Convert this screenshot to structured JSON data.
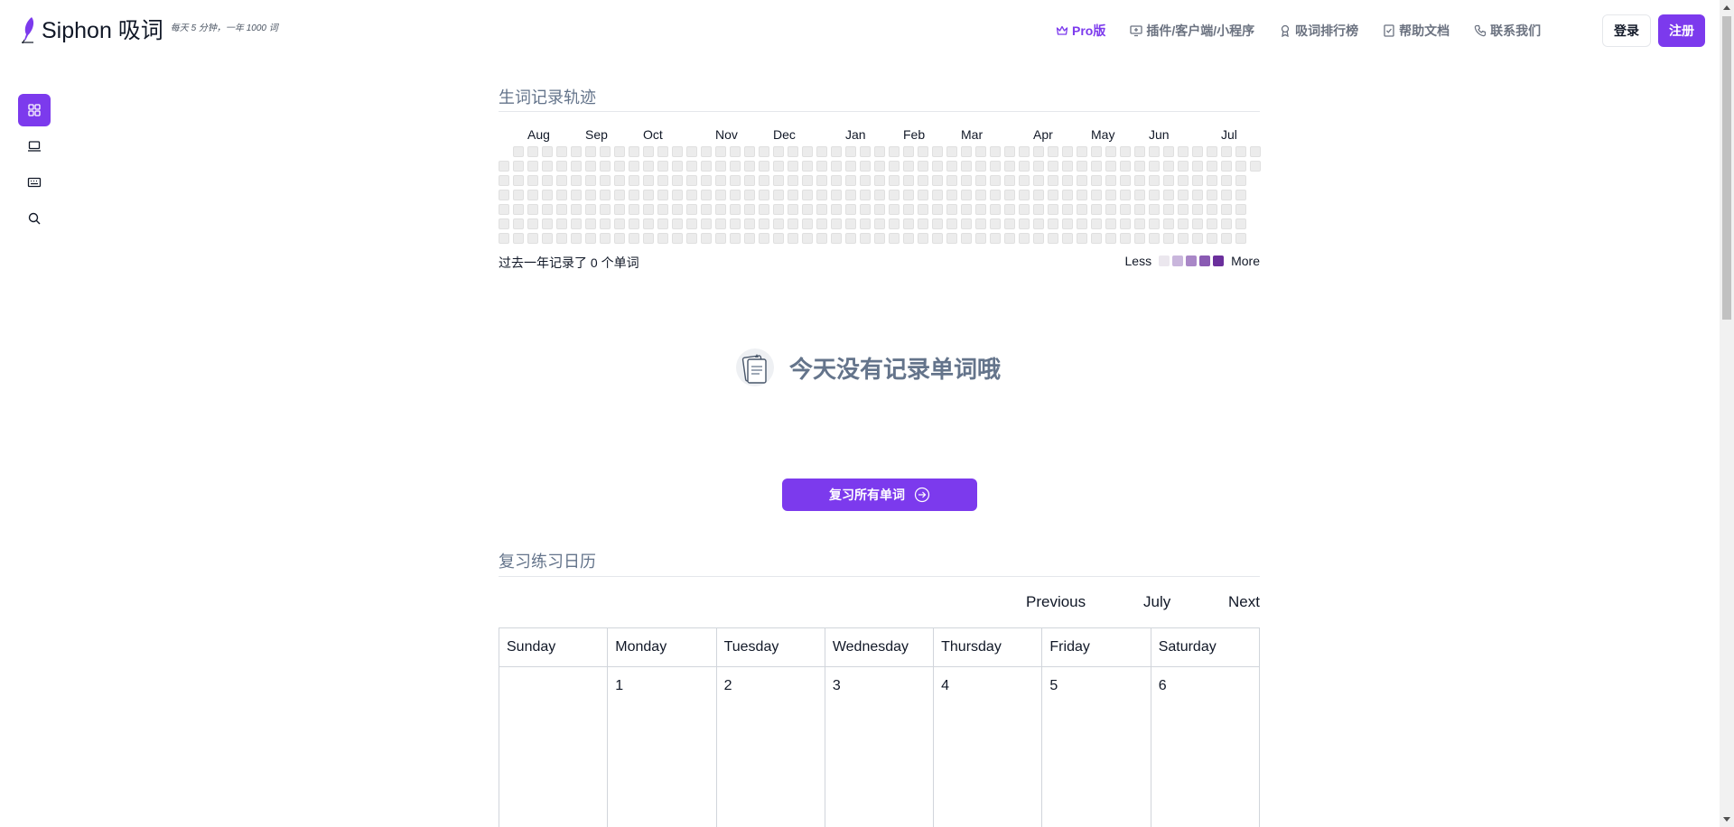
{
  "app": {
    "title": "Siphon 吸词",
    "slogan": "每天 5 分钟，一年 1000 词"
  },
  "nav": {
    "items": [
      {
        "label": "Pro版",
        "icon": "crown-icon"
      },
      {
        "label": "插件/客户端/小程序",
        "icon": "monitor-plus-icon"
      },
      {
        "label": "吸词排行榜",
        "icon": "award-icon"
      },
      {
        "label": "帮助文档",
        "icon": "checklist-icon"
      },
      {
        "label": "联系我们",
        "icon": "phone-icon"
      }
    ],
    "login": "登录",
    "register": "注册"
  },
  "sidebar": {
    "items": [
      {
        "icon": "grid-icon",
        "active": true
      },
      {
        "icon": "laptop-icon",
        "active": false
      },
      {
        "icon": "keyboard-icon",
        "active": false
      },
      {
        "icon": "search-icon",
        "active": false
      }
    ]
  },
  "heatmap": {
    "title": "生词记录轨迹",
    "months": [
      "Aug",
      "Sep",
      "Oct",
      "Nov",
      "Dec",
      "Jan",
      "Feb",
      "Mar",
      "Apr",
      "May",
      "Jun",
      "Jul"
    ],
    "summary": "过去一年记录了 0 个单词",
    "legend_less": "Less",
    "legend_more": "More",
    "legend_colors": [
      "#ebe7ee",
      "#c9b6dc",
      "#a987c7",
      "#8a5bb3",
      "#6b2f9c"
    ],
    "empty_color": "#ececec"
  },
  "empty_state": {
    "text": "今天没有记录单词哦"
  },
  "review_button": {
    "label": "复习所有单词"
  },
  "calendar": {
    "title": "复习练习日历",
    "prev": "Previous",
    "month": "July",
    "next": "Next",
    "weekdays": [
      "Sunday",
      "Monday",
      "Tuesday",
      "Wednesday",
      "Thursday",
      "Friday",
      "Saturday"
    ],
    "first_week": [
      "",
      "1",
      "2",
      "3",
      "4",
      "5",
      "6"
    ]
  },
  "colors": {
    "accent": "#7c3aed",
    "muted_text": "#64748b"
  }
}
